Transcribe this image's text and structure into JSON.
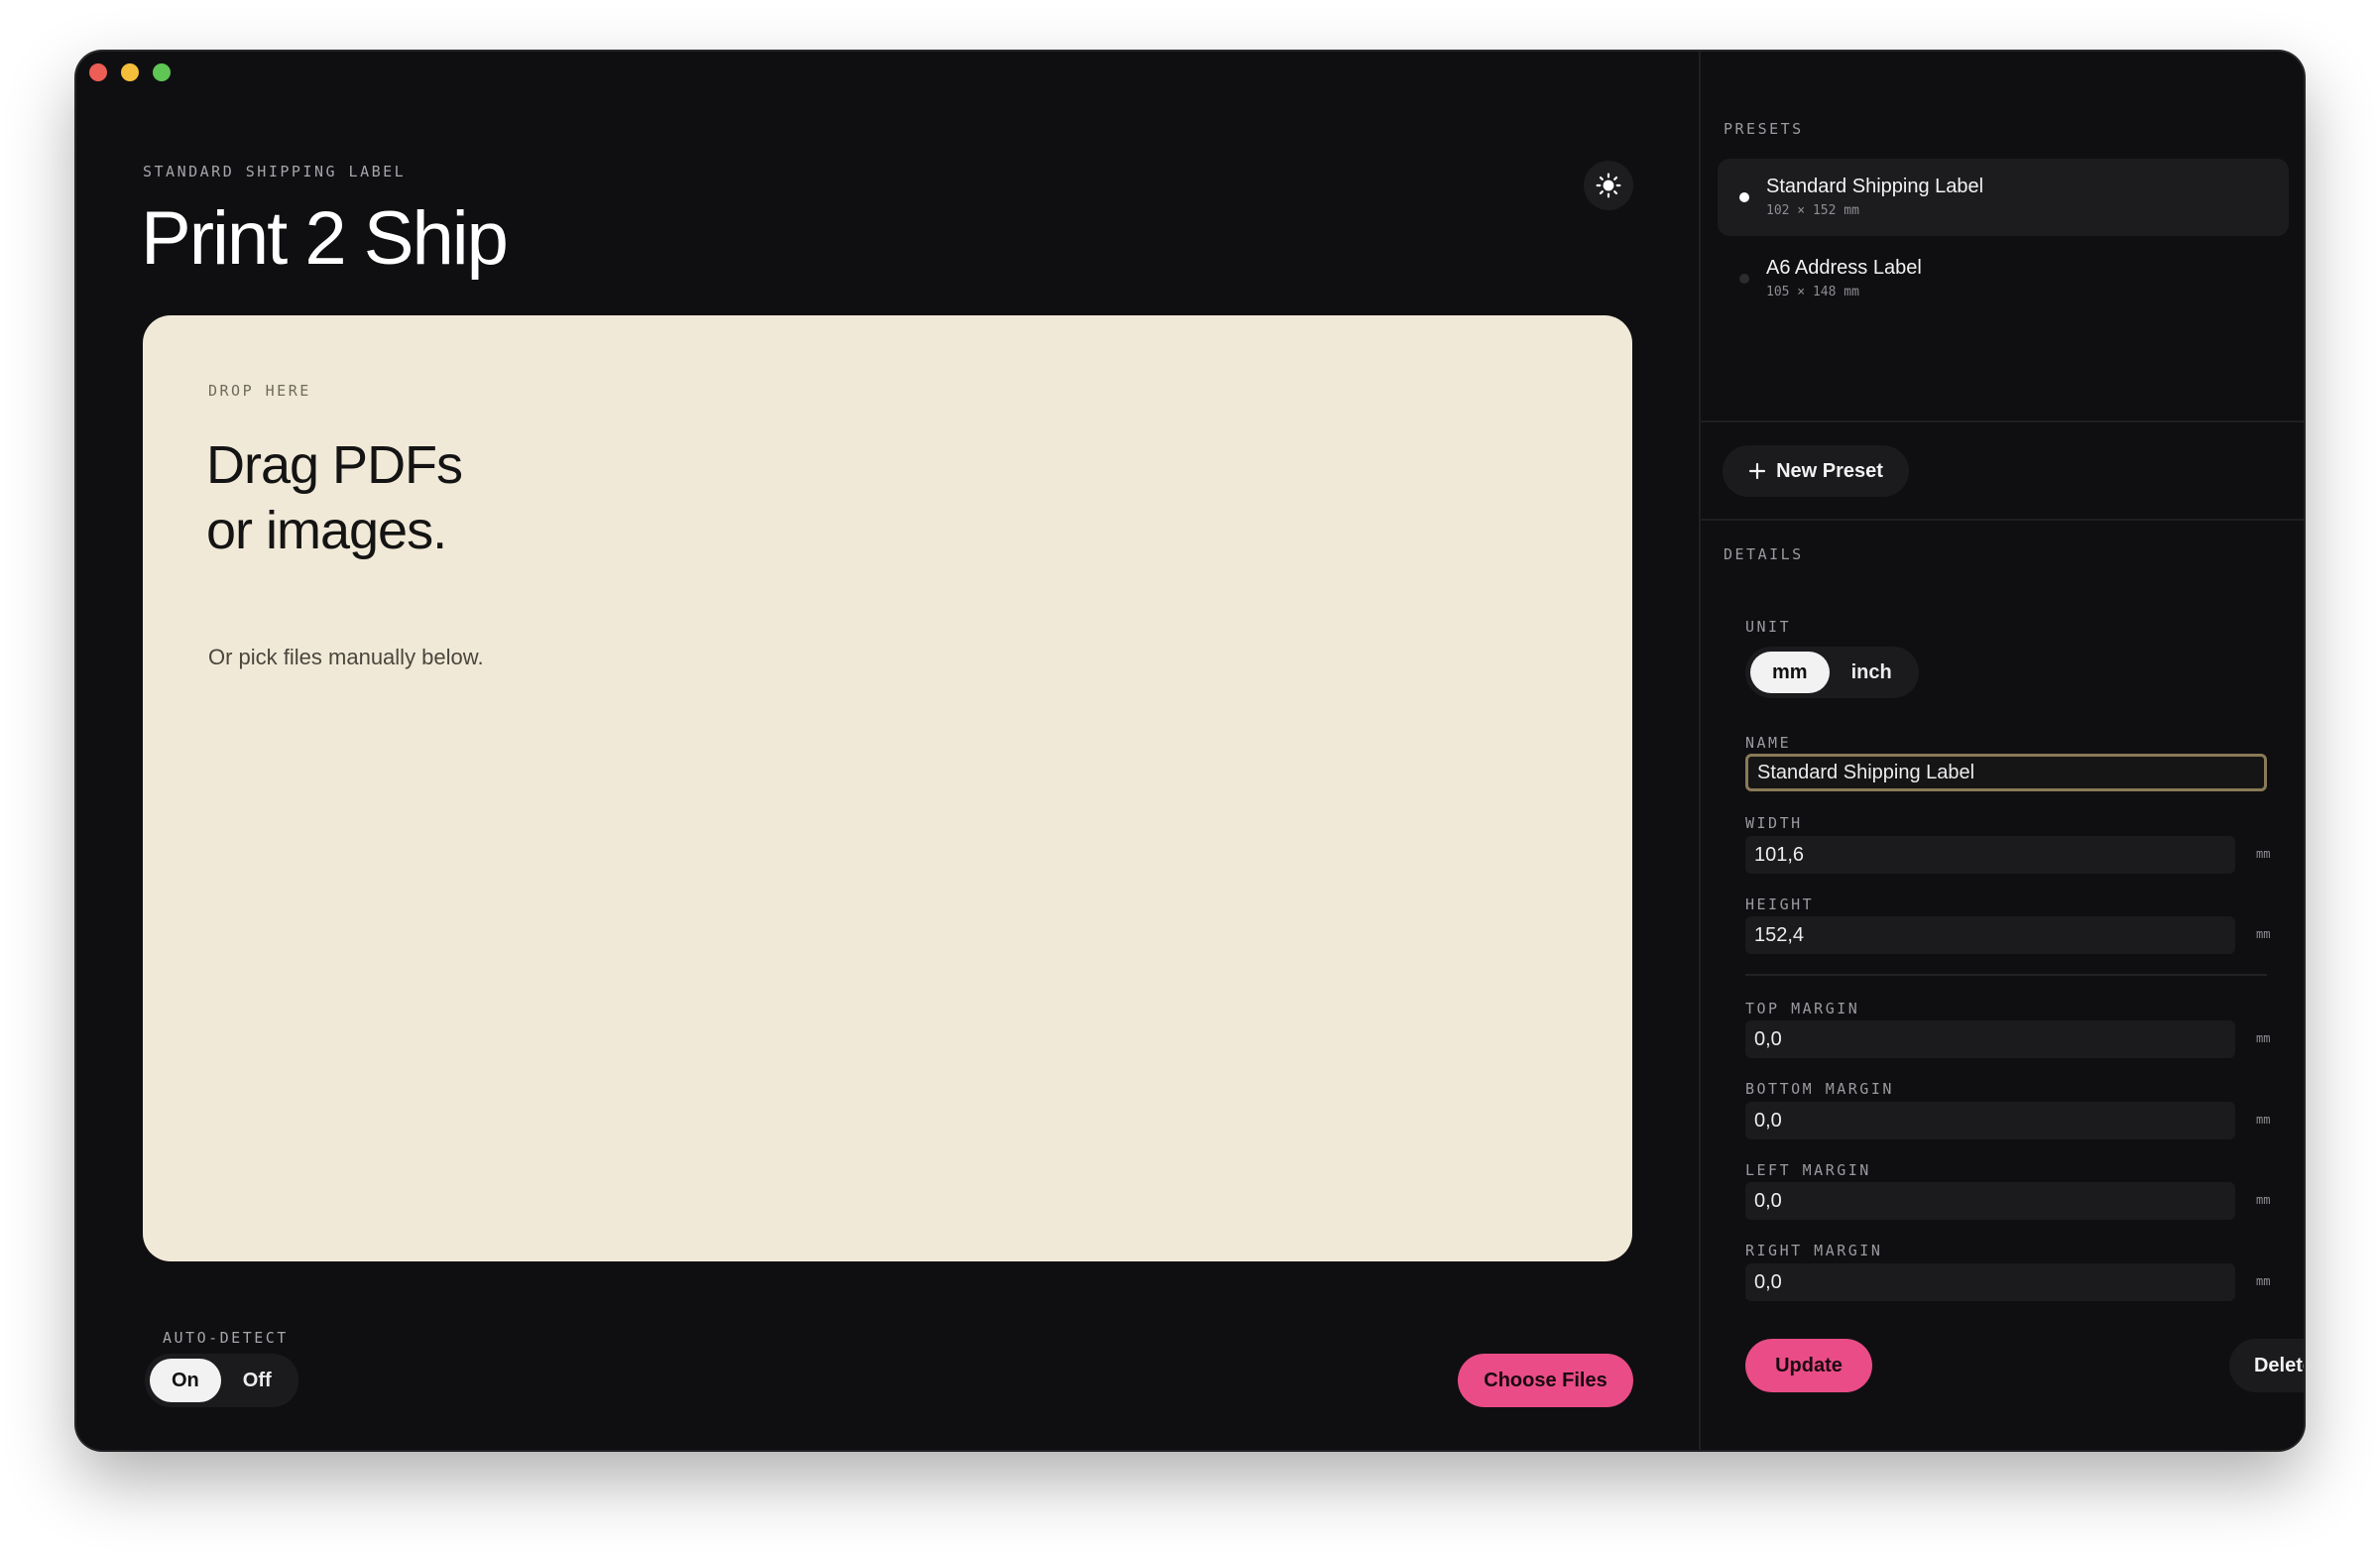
{
  "window": {
    "eyebrow": "STANDARD SHIPPING LABEL",
    "title": "Print 2 Ship"
  },
  "dropzone": {
    "eyebrow": "DROP HERE",
    "title_line1": "Drag PDFs",
    "title_line2": "or images.",
    "subtitle": "Or pick files manually below."
  },
  "auto_detect": {
    "label": "AUTO-DETECT",
    "options": [
      "On",
      "Off"
    ],
    "selected": "On"
  },
  "choose_files_label": "Choose Files",
  "sidebar": {
    "presets_label": "PRESETS",
    "presets": [
      {
        "name": "Standard Shipping Label",
        "size": "102 × 152 mm",
        "active": true
      },
      {
        "name": "A6 Address Label",
        "size": "105 × 148 mm",
        "active": false
      }
    ],
    "new_preset_label": "New Preset",
    "details_label": "DETAILS",
    "unit": {
      "label": "UNIT",
      "options": [
        "mm",
        "inch"
      ],
      "selected": "mm"
    },
    "name_field": {
      "label": "NAME",
      "value": "Standard Shipping Label"
    },
    "width_field": {
      "label": "WIDTH",
      "value": "101,6",
      "unit": "mm"
    },
    "height_field": {
      "label": "HEIGHT",
      "value": "152,4",
      "unit": "mm"
    },
    "top_margin_field": {
      "label": "TOP MARGIN",
      "value": "0,0",
      "unit": "mm"
    },
    "bottom_margin_field": {
      "label": "BOTTOM MARGIN",
      "value": "0,0",
      "unit": "mm"
    },
    "left_margin_field": {
      "label": "LEFT MARGIN",
      "value": "0,0",
      "unit": "mm"
    },
    "right_margin_field": {
      "label": "RIGHT MARGIN",
      "value": "0,0",
      "unit": "mm"
    },
    "update_label": "Update",
    "delete_label": "Delete"
  },
  "colors": {
    "accent": "#e94c86",
    "window_bg": "#0f0f11",
    "dropzone_bg": "#f1e9d7",
    "focus_border": "#8a7a57"
  },
  "icons": {
    "theme_toggle": "sun-icon",
    "new_preset": "plus-icon"
  }
}
